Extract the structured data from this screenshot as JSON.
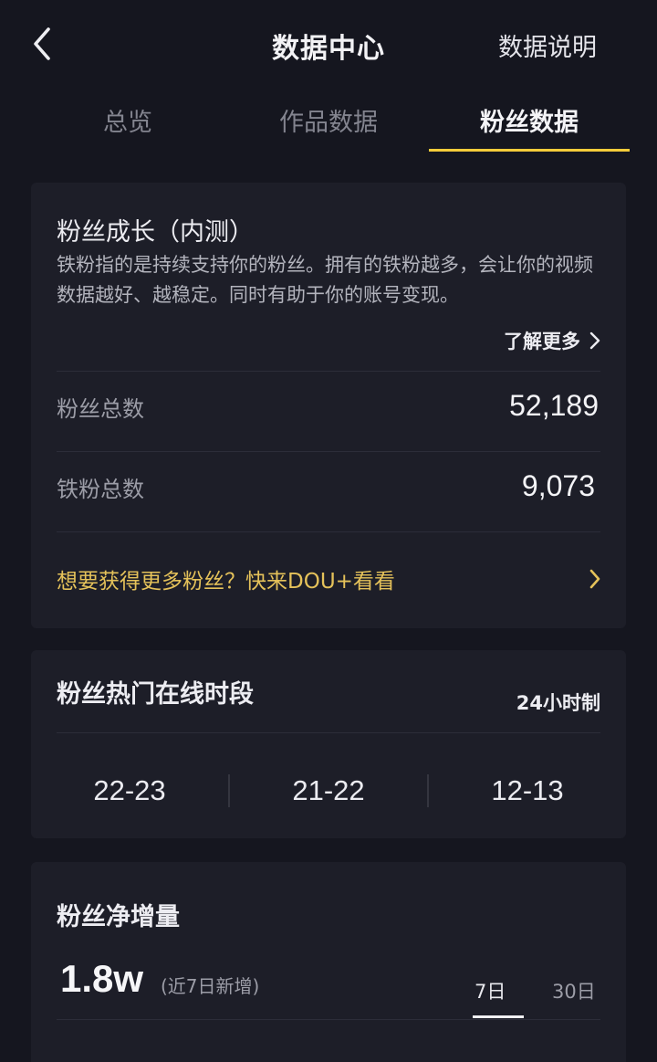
{
  "header": {
    "title": "数据中心",
    "help_link": "数据说明"
  },
  "tabs": [
    {
      "label": "总览",
      "active": false
    },
    {
      "label": "作品数据",
      "active": false
    },
    {
      "label": "粉丝数据",
      "active": true
    }
  ],
  "growth_card": {
    "title": "粉丝成长（内测）",
    "description": "铁粉指的是持续支持你的粉丝。拥有的铁粉越多，会让你的视频数据越好、越稳定。同时有助于你的账号变现。",
    "learn_more": "了解更多",
    "stats": [
      {
        "label": "粉丝总数",
        "value": "52,189"
      },
      {
        "label": "铁粉总数",
        "value": "9,073"
      }
    ],
    "promo": "想要获得更多粉丝？快来DOU+看看"
  },
  "online_card": {
    "title": "粉丝热门在线时段",
    "clock_format": "24小时制",
    "hours": [
      "22-23",
      "21-22",
      "12-13"
    ]
  },
  "net_growth_card": {
    "title": "粉丝净增量",
    "value": "1.8w",
    "note": "(近7日新增)",
    "periods": [
      {
        "label": "7日",
        "active": true
      },
      {
        "label": "30日",
        "active": false
      }
    ]
  },
  "colors": {
    "background": "#15161f",
    "card": "#1d1e28",
    "accent_tab": "#f4cc3a",
    "promo_text": "#e5c25a"
  },
  "icons": {
    "back": "chevron-left-icon",
    "learn_more": "chevron-right-icon",
    "promo": "chevron-right-icon"
  }
}
